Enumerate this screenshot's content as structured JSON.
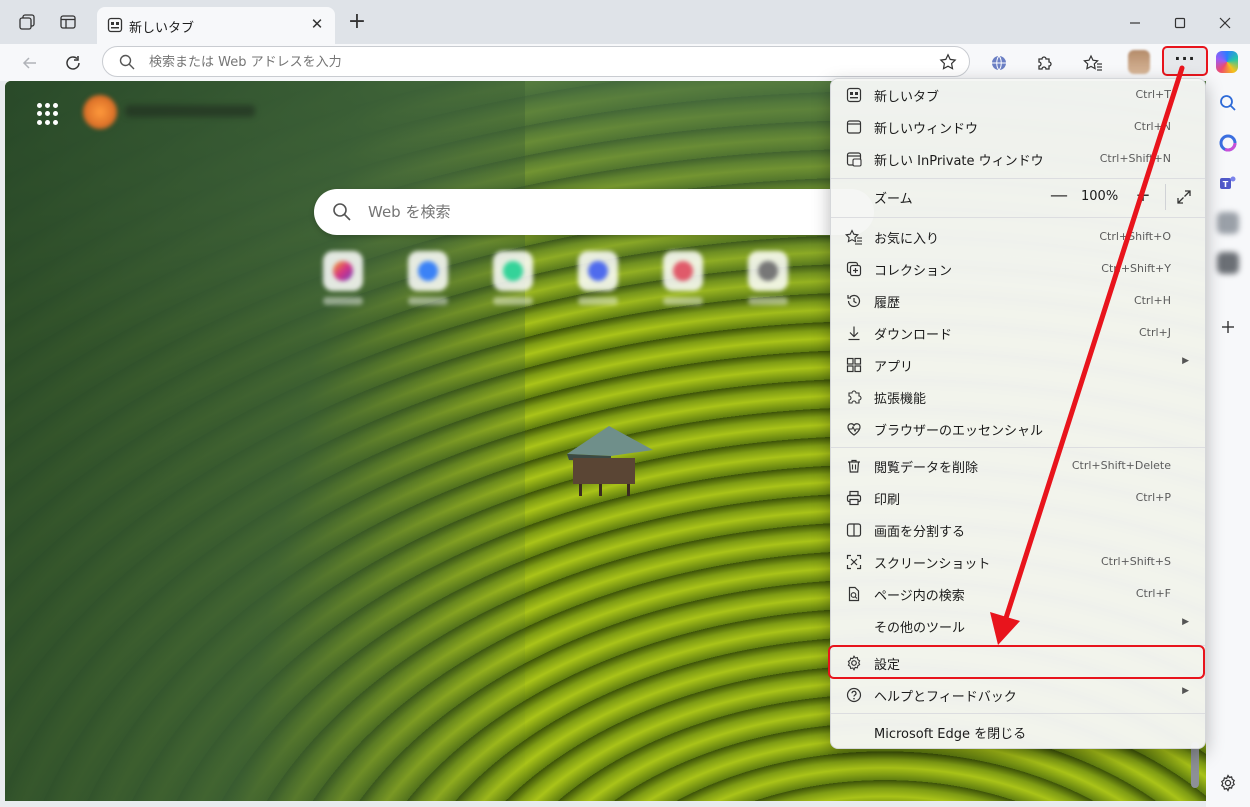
{
  "tab": {
    "title": "新しいタブ"
  },
  "address_bar": {
    "placeholder": "検索または Web アドレスを入力"
  },
  "new_tab_page": {
    "search_placeholder": "Web を検索"
  },
  "colors": {
    "highlight": "#e8141c",
    "menu_bg": "#f5f6f4",
    "titlebar": "#dfe3e8"
  },
  "menu": {
    "items": [
      {
        "label": "新しいタブ",
        "shortcut": "Ctrl+T",
        "icon": "new-tab-icon"
      },
      {
        "label": "新しいウィンドウ",
        "shortcut": "Ctrl+N",
        "icon": "new-window-icon"
      },
      {
        "label": "新しい InPrivate ウィンドウ",
        "shortcut": "Ctrl+Shift+N",
        "icon": "inprivate-icon"
      },
      {
        "label": "お気に入り",
        "shortcut": "Ctrl+Shift+O",
        "icon": "favorites-icon"
      },
      {
        "label": "コレクション",
        "shortcut": "Ctrl+Shift+Y",
        "icon": "collections-icon"
      },
      {
        "label": "履歴",
        "shortcut": "Ctrl+H",
        "icon": "history-icon"
      },
      {
        "label": "ダウンロード",
        "shortcut": "Ctrl+J",
        "icon": "download-icon"
      },
      {
        "label": "アプリ",
        "shortcut": "",
        "icon": "apps-icon"
      },
      {
        "label": "拡張機能",
        "shortcut": "",
        "icon": "extensions-icon"
      },
      {
        "label": "ブラウザーのエッセンシャル",
        "shortcut": "",
        "icon": "heart-pulse-icon"
      },
      {
        "label": "閲覧データを削除",
        "shortcut": "Ctrl+Shift+Delete",
        "icon": "trash-icon"
      },
      {
        "label": "印刷",
        "shortcut": "Ctrl+P",
        "icon": "print-icon"
      },
      {
        "label": "画面を分割する",
        "shortcut": "",
        "icon": "split-screen-icon"
      },
      {
        "label": "スクリーンショット",
        "shortcut": "Ctrl+Shift+S",
        "icon": "screenshot-icon"
      },
      {
        "label": "ページ内の検索",
        "shortcut": "Ctrl+F",
        "icon": "find-in-page-icon"
      },
      {
        "label": "その他のツール",
        "shortcut": "",
        "icon": ""
      },
      {
        "label": "設定",
        "shortcut": "",
        "icon": "settings-icon"
      },
      {
        "label": "ヘルプとフィードバック",
        "shortcut": "",
        "icon": "help-icon"
      },
      {
        "label": "Microsoft Edge を閉じる",
        "shortcut": "",
        "icon": ""
      }
    ],
    "zoom": {
      "label": "ズーム",
      "value": "100%",
      "minus": "—",
      "plus": "+"
    }
  }
}
